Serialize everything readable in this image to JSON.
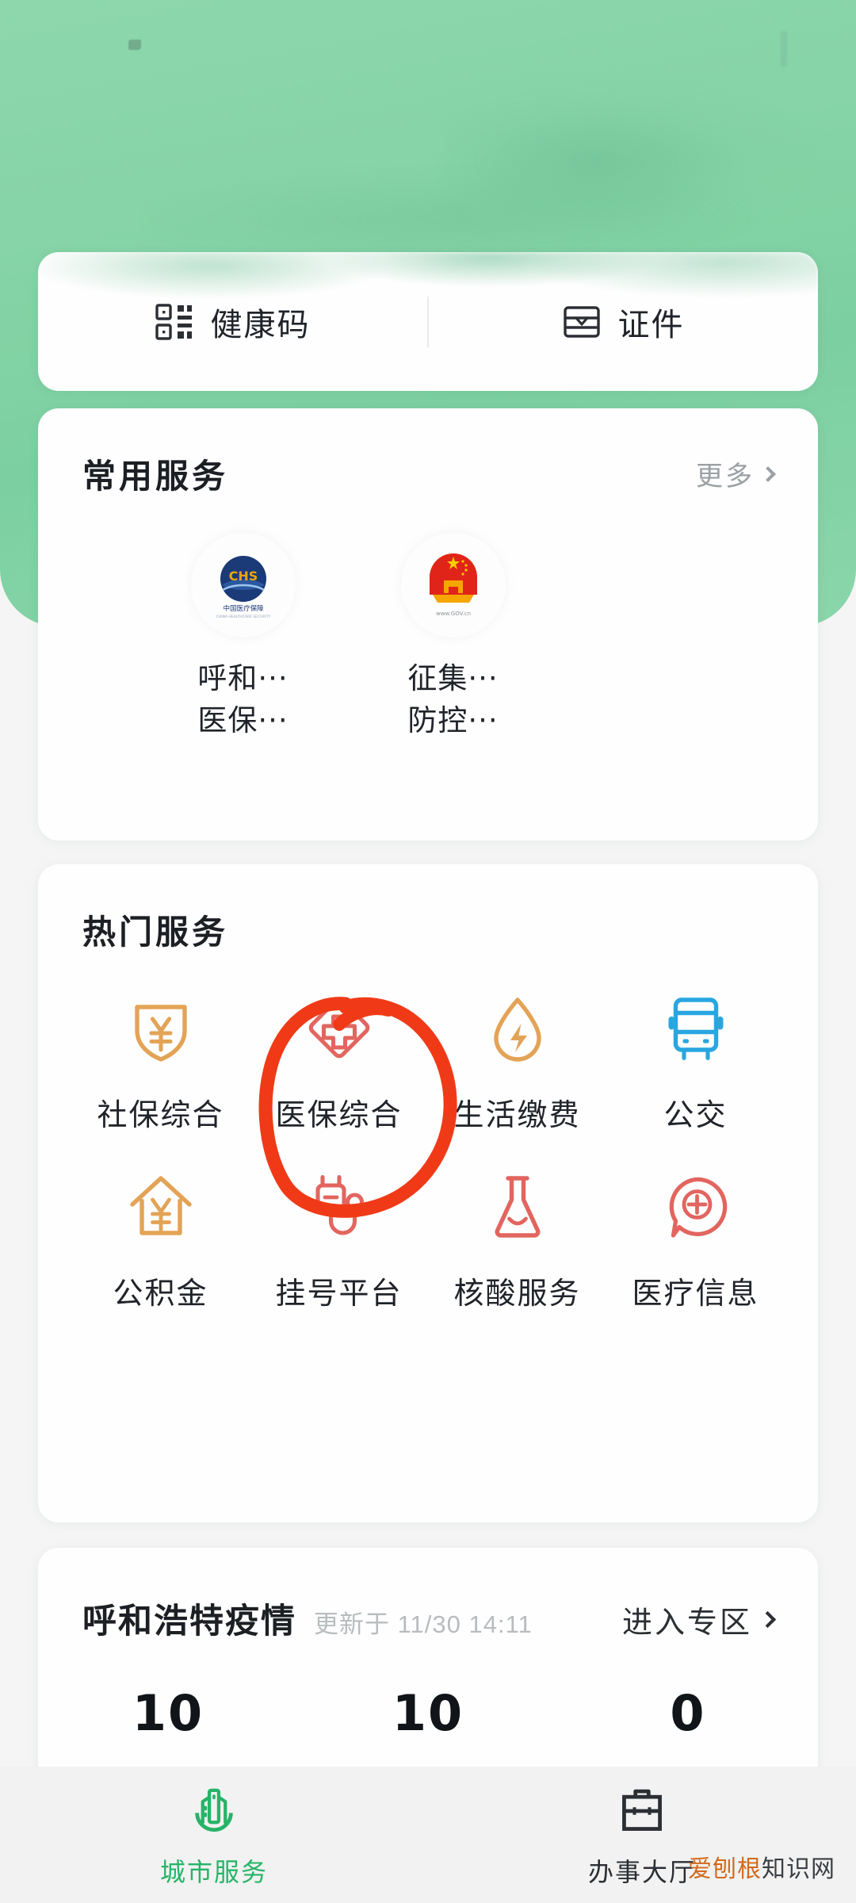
{
  "theme": {
    "hero_green": "#84d3a6",
    "page_bg": "#f4f5f4",
    "card_bg": "#fefefe",
    "accent_green": "#27b368",
    "orange": "#e3a356",
    "red": "#e2655f",
    "blue": "#29a6e0",
    "annotation_red": "#f03a17"
  },
  "quick": {
    "items": [
      {
        "icon": "qr-code-icon",
        "label": "健康码"
      },
      {
        "icon": "id-card-icon",
        "label": "证件"
      }
    ]
  },
  "common_services": {
    "title": "常用服务",
    "more_label": "更多",
    "items": [
      {
        "logo": "china-healthcare-security-logo",
        "logo_caption": "中国医疗保障",
        "line1": "呼和···",
        "line2": "医保···"
      },
      {
        "logo": "china-gov-emblem-logo",
        "logo_caption": "www.GOV.cn",
        "line1": "征集···",
        "line2": "防控···"
      }
    ]
  },
  "hot_services": {
    "title": "热门服务",
    "items": [
      {
        "icon": "shield-yuan-icon",
        "label": "社保综合",
        "color": "#e3a356"
      },
      {
        "icon": "diamond-cross-icon",
        "label": "医保综合",
        "color": "#e2655f",
        "annotated": true
      },
      {
        "icon": "water-drop-bolt-icon",
        "label": "生活缴费",
        "color": "#e3a356"
      },
      {
        "icon": "bus-icon",
        "label": "公交",
        "color": "#29a6e0"
      },
      {
        "icon": "house-yuan-icon",
        "label": "公积金",
        "color": "#e3a356"
      },
      {
        "icon": "stethoscope-icon",
        "label": "挂号平台",
        "color": "#e2655f"
      },
      {
        "icon": "flask-icon",
        "label": "核酸服务",
        "color": "#e2655f"
      },
      {
        "icon": "speech-cross-icon",
        "label": "医疗信息",
        "color": "#e2655f"
      }
    ]
  },
  "epidemic": {
    "title": "呼和浩特疫情",
    "updated": "更新于 11/30 14:11",
    "enter_label": "进入专区",
    "stats": [
      {
        "value": "10"
      },
      {
        "value": "10"
      },
      {
        "value": "0"
      }
    ]
  },
  "tabbar": {
    "items": [
      {
        "icon": "city-buildings-icon",
        "label": "城市服务",
        "active": true
      },
      {
        "icon": "briefcase-icon",
        "label": "办事大厅",
        "active": false
      }
    ]
  },
  "watermark": {
    "part1": "爱刨根",
    "part2": "知识网"
  }
}
